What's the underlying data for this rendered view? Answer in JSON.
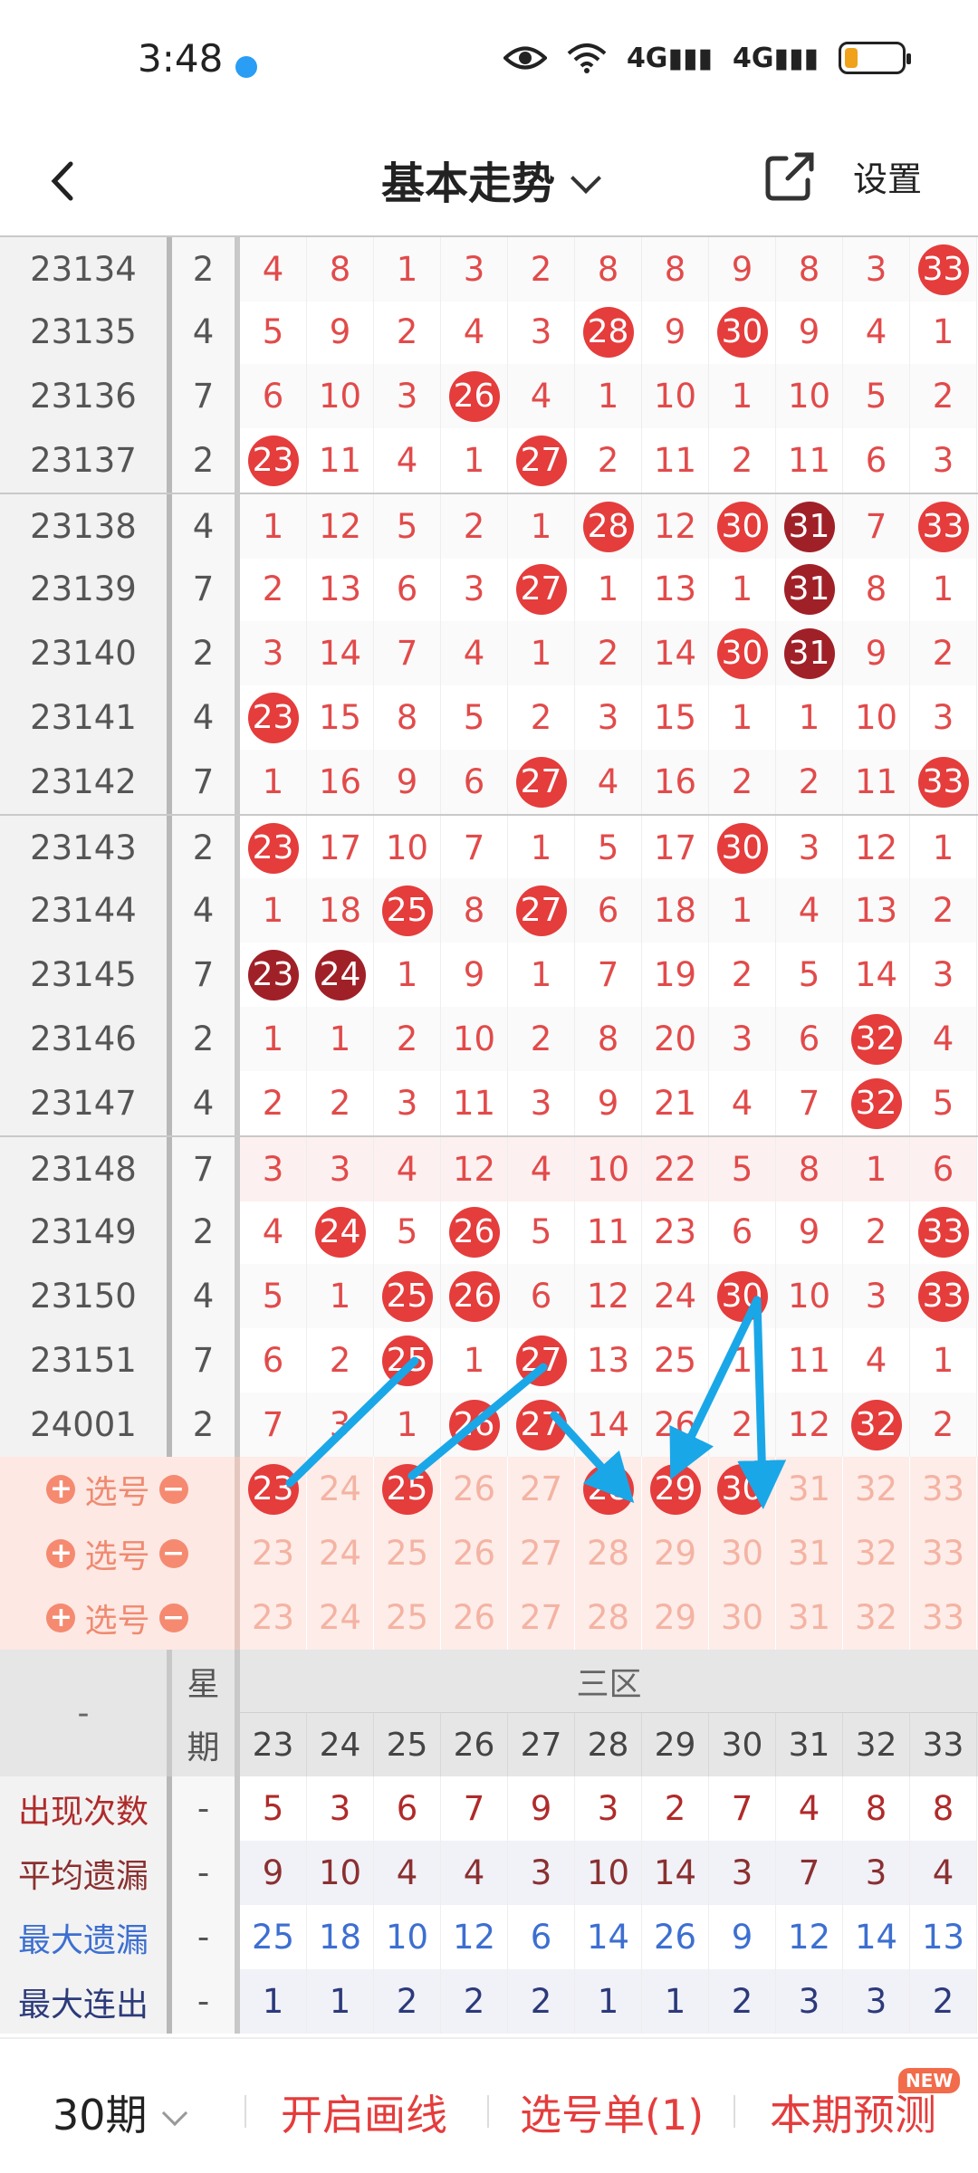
{
  "status_bar": {
    "time": "3:48",
    "network": [
      "4G",
      "4G"
    ]
  },
  "nav": {
    "title": "基本走势",
    "settings": "设置"
  },
  "draws": [
    {
      "period": "23134",
      "week": "2",
      "cells": [
        "4",
        "8",
        "1",
        "3",
        "2",
        "8",
        "8",
        "9",
        "8",
        "3",
        "33"
      ],
      "balls": {
        "10": "red"
      }
    },
    {
      "period": "23135",
      "week": "4",
      "cells": [
        "5",
        "9",
        "2",
        "4",
        "3",
        "28",
        "9",
        "30",
        "9",
        "4",
        "1"
      ],
      "balls": {
        "5": "red",
        "7": "red"
      }
    },
    {
      "period": "23136",
      "week": "7",
      "cells": [
        "6",
        "10",
        "3",
        "26",
        "4",
        "1",
        "10",
        "1",
        "10",
        "5",
        "2"
      ],
      "balls": {
        "3": "red"
      }
    },
    {
      "period": "23137",
      "week": "2",
      "cells": [
        "23",
        "11",
        "4",
        "1",
        "27",
        "2",
        "11",
        "2",
        "11",
        "6",
        "3"
      ],
      "balls": {
        "0": "red",
        "4": "red"
      }
    },
    {
      "period": "23138",
      "week": "4",
      "cells": [
        "1",
        "12",
        "5",
        "2",
        "1",
        "28",
        "12",
        "30",
        "31",
        "7",
        "33"
      ],
      "balls": {
        "5": "red",
        "7": "red",
        "8": "dark",
        "10": "red"
      }
    },
    {
      "period": "23139",
      "week": "7",
      "cells": [
        "2",
        "13",
        "6",
        "3",
        "27",
        "1",
        "13",
        "1",
        "31",
        "8",
        "1"
      ],
      "balls": {
        "4": "red",
        "8": "dark"
      }
    },
    {
      "period": "23140",
      "week": "2",
      "cells": [
        "3",
        "14",
        "7",
        "4",
        "1",
        "2",
        "14",
        "30",
        "31",
        "9",
        "2"
      ],
      "balls": {
        "7": "red",
        "8": "dark"
      }
    },
    {
      "period": "23141",
      "week": "4",
      "cells": [
        "23",
        "15",
        "8",
        "5",
        "2",
        "3",
        "15",
        "1",
        "1",
        "10",
        "3"
      ],
      "balls": {
        "0": "red"
      }
    },
    {
      "period": "23142",
      "week": "7",
      "cells": [
        "1",
        "16",
        "9",
        "6",
        "27",
        "4",
        "16",
        "2",
        "2",
        "11",
        "33"
      ],
      "balls": {
        "4": "red",
        "10": "red"
      }
    },
    {
      "period": "23143",
      "week": "2",
      "cells": [
        "23",
        "17",
        "10",
        "7",
        "1",
        "5",
        "17",
        "30",
        "3",
        "12",
        "1"
      ],
      "balls": {
        "0": "red",
        "7": "red"
      }
    },
    {
      "period": "23144",
      "week": "4",
      "cells": [
        "1",
        "18",
        "25",
        "8",
        "27",
        "6",
        "18",
        "1",
        "4",
        "13",
        "2"
      ],
      "balls": {
        "2": "red",
        "4": "red"
      }
    },
    {
      "period": "23145",
      "week": "7",
      "cells": [
        "23",
        "24",
        "1",
        "9",
        "1",
        "7",
        "19",
        "2",
        "5",
        "14",
        "3"
      ],
      "balls": {
        "0": "dark",
        "1": "dark"
      }
    },
    {
      "period": "23146",
      "week": "2",
      "cells": [
        "1",
        "1",
        "2",
        "10",
        "2",
        "8",
        "20",
        "3",
        "6",
        "32",
        "4"
      ],
      "balls": {
        "9": "red"
      }
    },
    {
      "period": "23147",
      "week": "4",
      "cells": [
        "2",
        "2",
        "3",
        "11",
        "3",
        "9",
        "21",
        "4",
        "7",
        "32",
        "5"
      ],
      "balls": {
        "9": "red"
      }
    },
    {
      "period": "23148",
      "week": "7",
      "cells": [
        "3",
        "3",
        "4",
        "12",
        "4",
        "10",
        "22",
        "5",
        "8",
        "1",
        "6"
      ],
      "balls": {}
    },
    {
      "period": "23149",
      "week": "2",
      "cells": [
        "4",
        "24",
        "5",
        "26",
        "5",
        "11",
        "23",
        "6",
        "9",
        "2",
        "33"
      ],
      "balls": {
        "1": "red",
        "3": "red",
        "10": "red"
      }
    },
    {
      "period": "23150",
      "week": "4",
      "cells": [
        "5",
        "1",
        "25",
        "26",
        "6",
        "12",
        "24",
        "30",
        "10",
        "3",
        "33"
      ],
      "balls": {
        "2": "red",
        "3": "red",
        "7": "red",
        "10": "red"
      }
    },
    {
      "period": "23151",
      "week": "7",
      "cells": [
        "6",
        "2",
        "25",
        "1",
        "27",
        "13",
        "25",
        "1",
        "11",
        "4",
        "1"
      ],
      "balls": {
        "2": "red",
        "4": "red"
      }
    },
    {
      "period": "24001",
      "week": "2",
      "cells": [
        "7",
        "3",
        "1",
        "26",
        "27",
        "14",
        "26",
        "2",
        "12",
        "32",
        "2"
      ],
      "balls": {
        "3": "red",
        "4": "red",
        "9": "red"
      }
    }
  ],
  "select_rows": [
    {
      "label": "选号",
      "cells": [
        "23",
        "24",
        "25",
        "26",
        "27",
        "28",
        "29",
        "30",
        "31",
        "32",
        "33"
      ],
      "balls": {
        "0": "red",
        "2": "red",
        "5": "red",
        "6": "red",
        "7": "red"
      }
    },
    {
      "label": "选号",
      "cells": [
        "23",
        "24",
        "25",
        "26",
        "27",
        "28",
        "29",
        "30",
        "31",
        "32",
        "33"
      ],
      "balls": {}
    },
    {
      "label": "选号",
      "cells": [
        "23",
        "24",
        "25",
        "26",
        "27",
        "28",
        "29",
        "30",
        "31",
        "32",
        "33"
      ],
      "balls": {}
    }
  ],
  "stats_header": {
    "dash": "-",
    "week_top": "星",
    "week_bottom": "期",
    "zone": "三区",
    "nums": [
      "23",
      "24",
      "25",
      "26",
      "27",
      "28",
      "29",
      "30",
      "31",
      "32",
      "33"
    ]
  },
  "stats": [
    {
      "label": "出现次数",
      "week": "-",
      "values": [
        "5",
        "3",
        "6",
        "7",
        "9",
        "3",
        "2",
        "7",
        "4",
        "8",
        "8"
      ]
    },
    {
      "label": "平均遗漏",
      "week": "-",
      "values": [
        "9",
        "10",
        "4",
        "4",
        "3",
        "10",
        "14",
        "3",
        "7",
        "3",
        "4"
      ]
    },
    {
      "label": "最大遗漏",
      "week": "-",
      "values": [
        "25",
        "18",
        "10",
        "12",
        "6",
        "14",
        "26",
        "9",
        "12",
        "14",
        "13"
      ]
    },
    {
      "label": "最大连出",
      "week": "-",
      "values": [
        "1",
        "1",
        "2",
        "2",
        "2",
        "1",
        "1",
        "2",
        "3",
        "3",
        "2"
      ]
    }
  ],
  "bottom": {
    "period": "30期",
    "draw_line": "开启画线",
    "selection": "选号单(1)",
    "predict": "本期预测",
    "badge": "NEW"
  },
  "colors": {
    "ball_red": "#e53c3c",
    "ball_dark": "#a02028",
    "arrow": "#1aa7e8",
    "number_red": "#e24a4a"
  }
}
